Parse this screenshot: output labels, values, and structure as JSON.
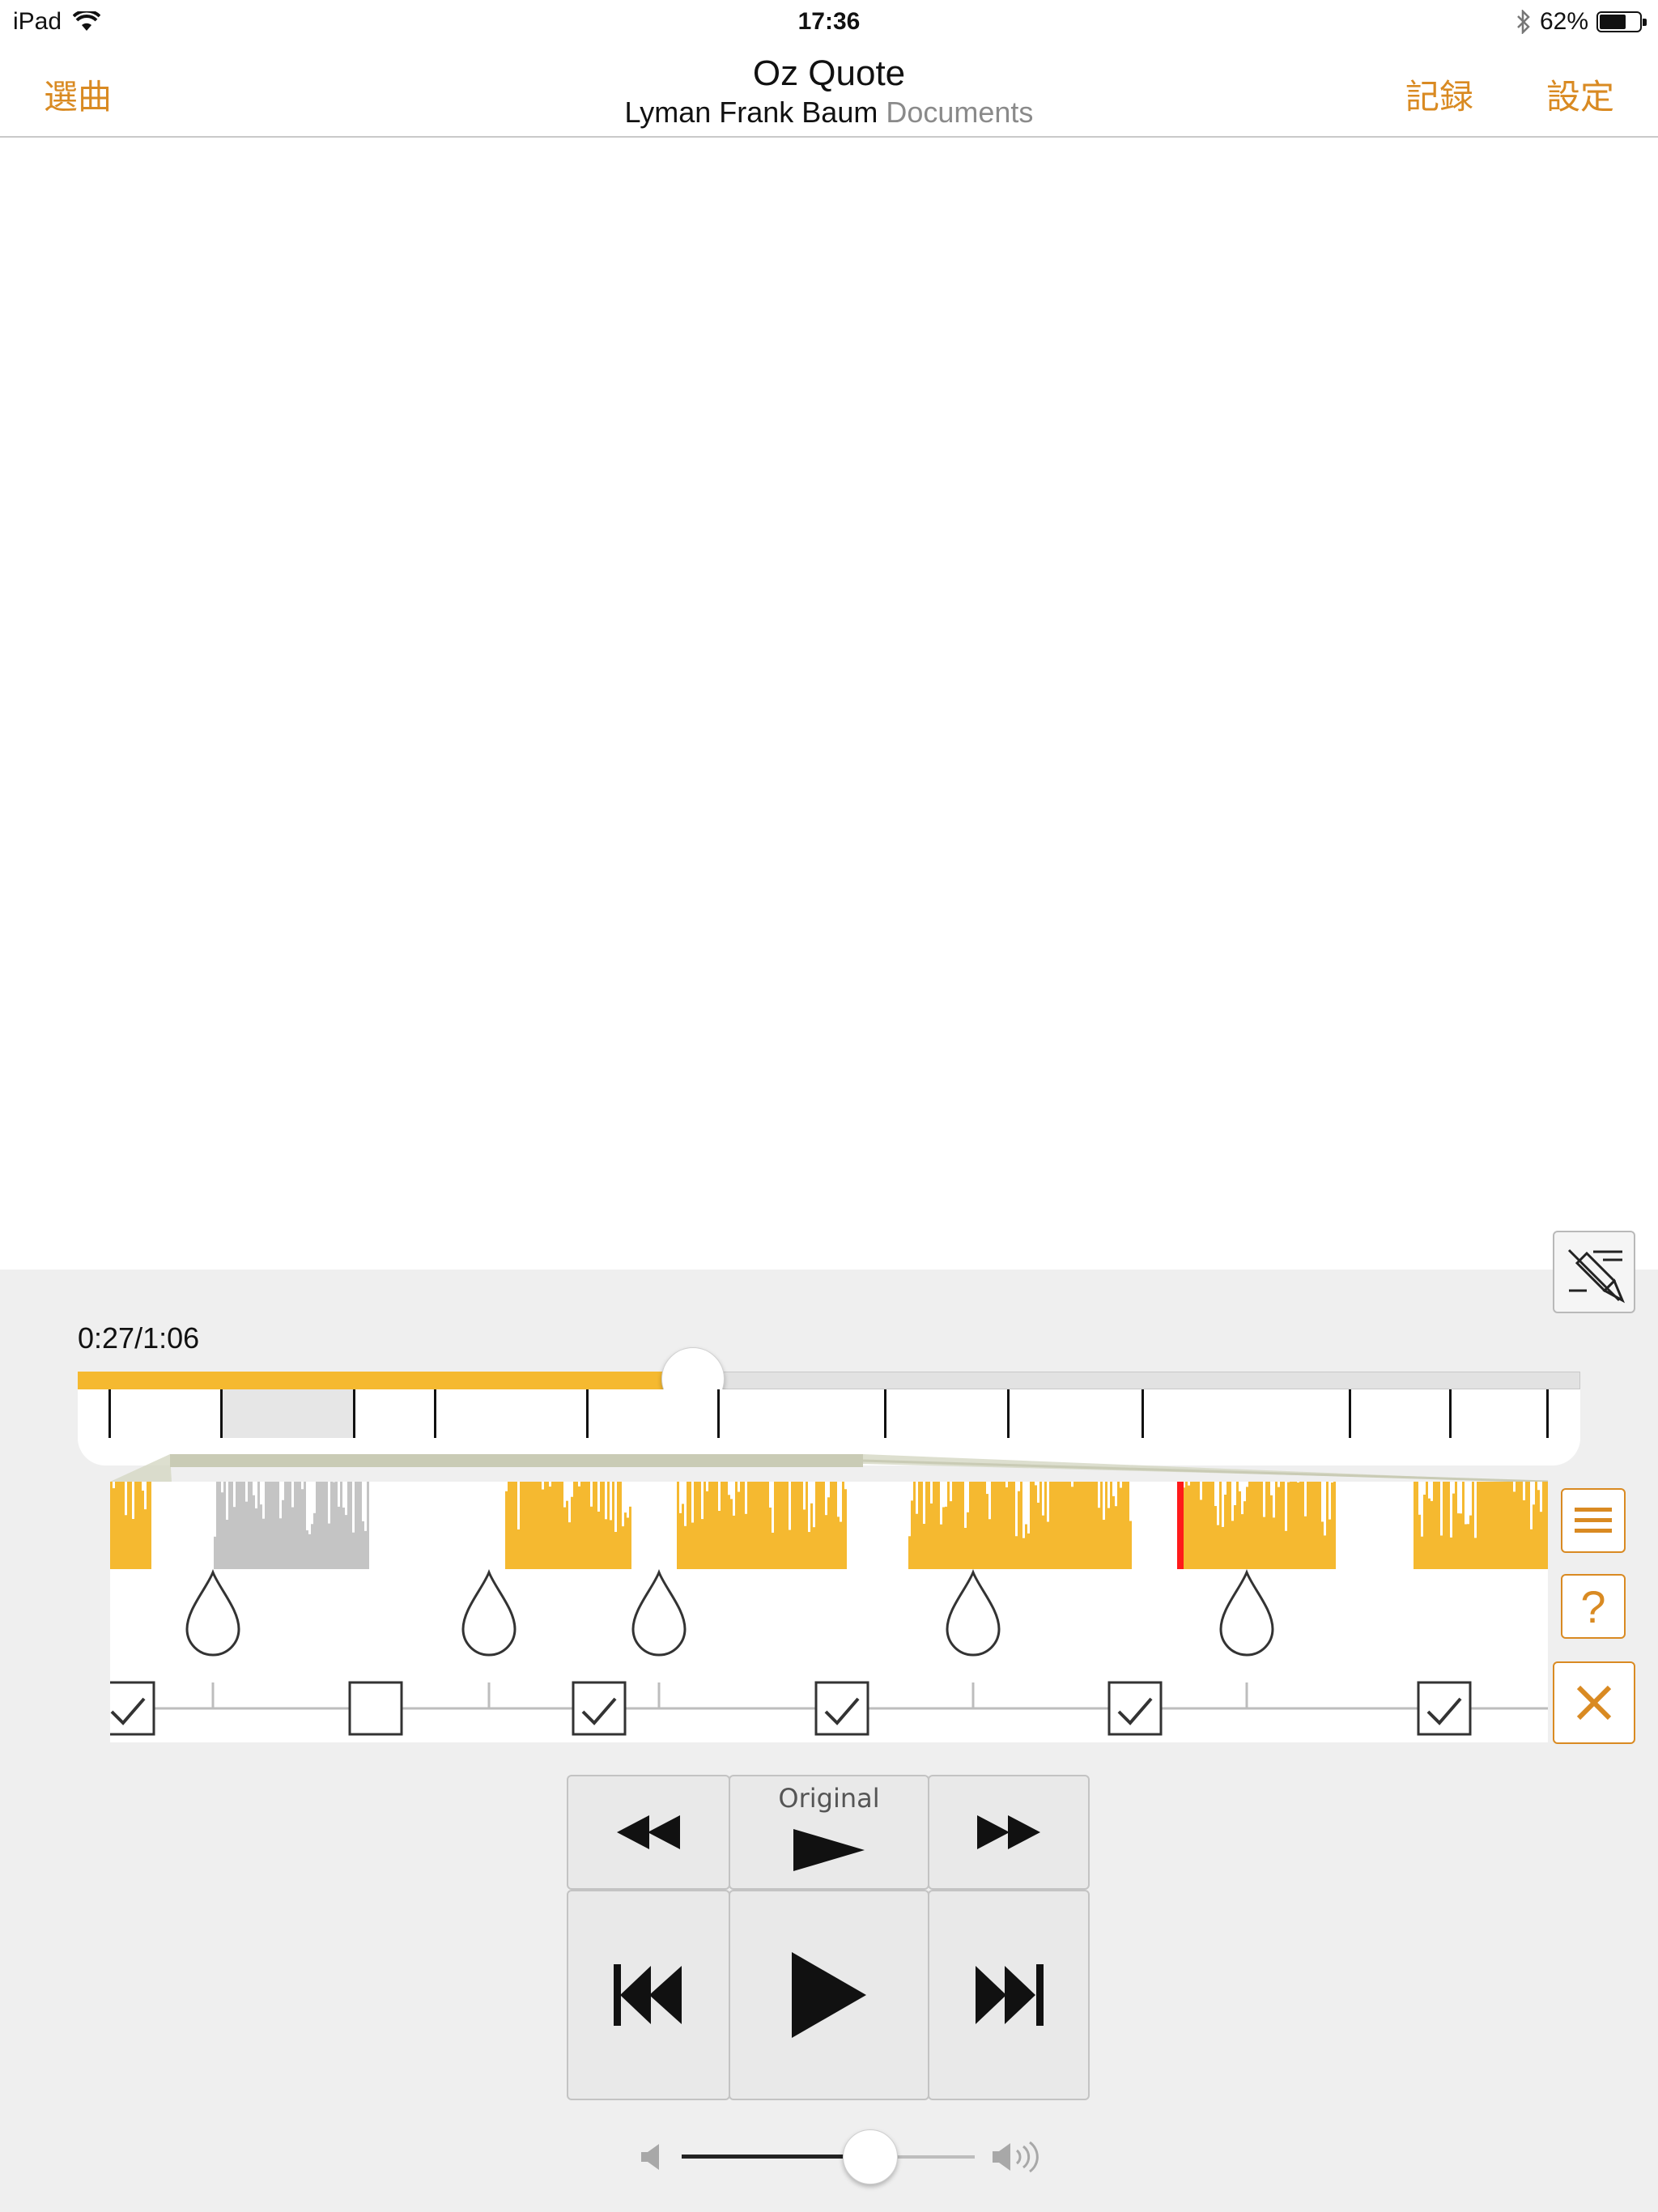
{
  "status": {
    "device": "iPad",
    "time": "17:36",
    "battery": "62%",
    "battery_level": 0.62,
    "wifi_icon": "wifi-icon",
    "bluetooth_icon": "bluetooth-icon"
  },
  "nav": {
    "left_label": "選曲",
    "title": "Oz Quote",
    "artist": "Lyman Frank Baum",
    "album": "Documents",
    "right1_label": "記録",
    "right2_label": "設定"
  },
  "player": {
    "time_display": "0:27/1:06",
    "elapsed_fraction": 0.409,
    "transport": {
      "original_label": "Original"
    },
    "volume_fraction": 0.64
  },
  "colors": {
    "accent": "#d98a22",
    "waveform": "#f5b930",
    "waveform_inactive": "#c4c4c4",
    "playhead": "#ff1a1a",
    "panel": "#efefef"
  },
  "side_buttons": {
    "list": "list-icon",
    "help": "?",
    "close": "close-icon"
  },
  "markers": {
    "checkbox_states": [
      true,
      false,
      true,
      true,
      true,
      true
    ],
    "drop_count": 5
  }
}
